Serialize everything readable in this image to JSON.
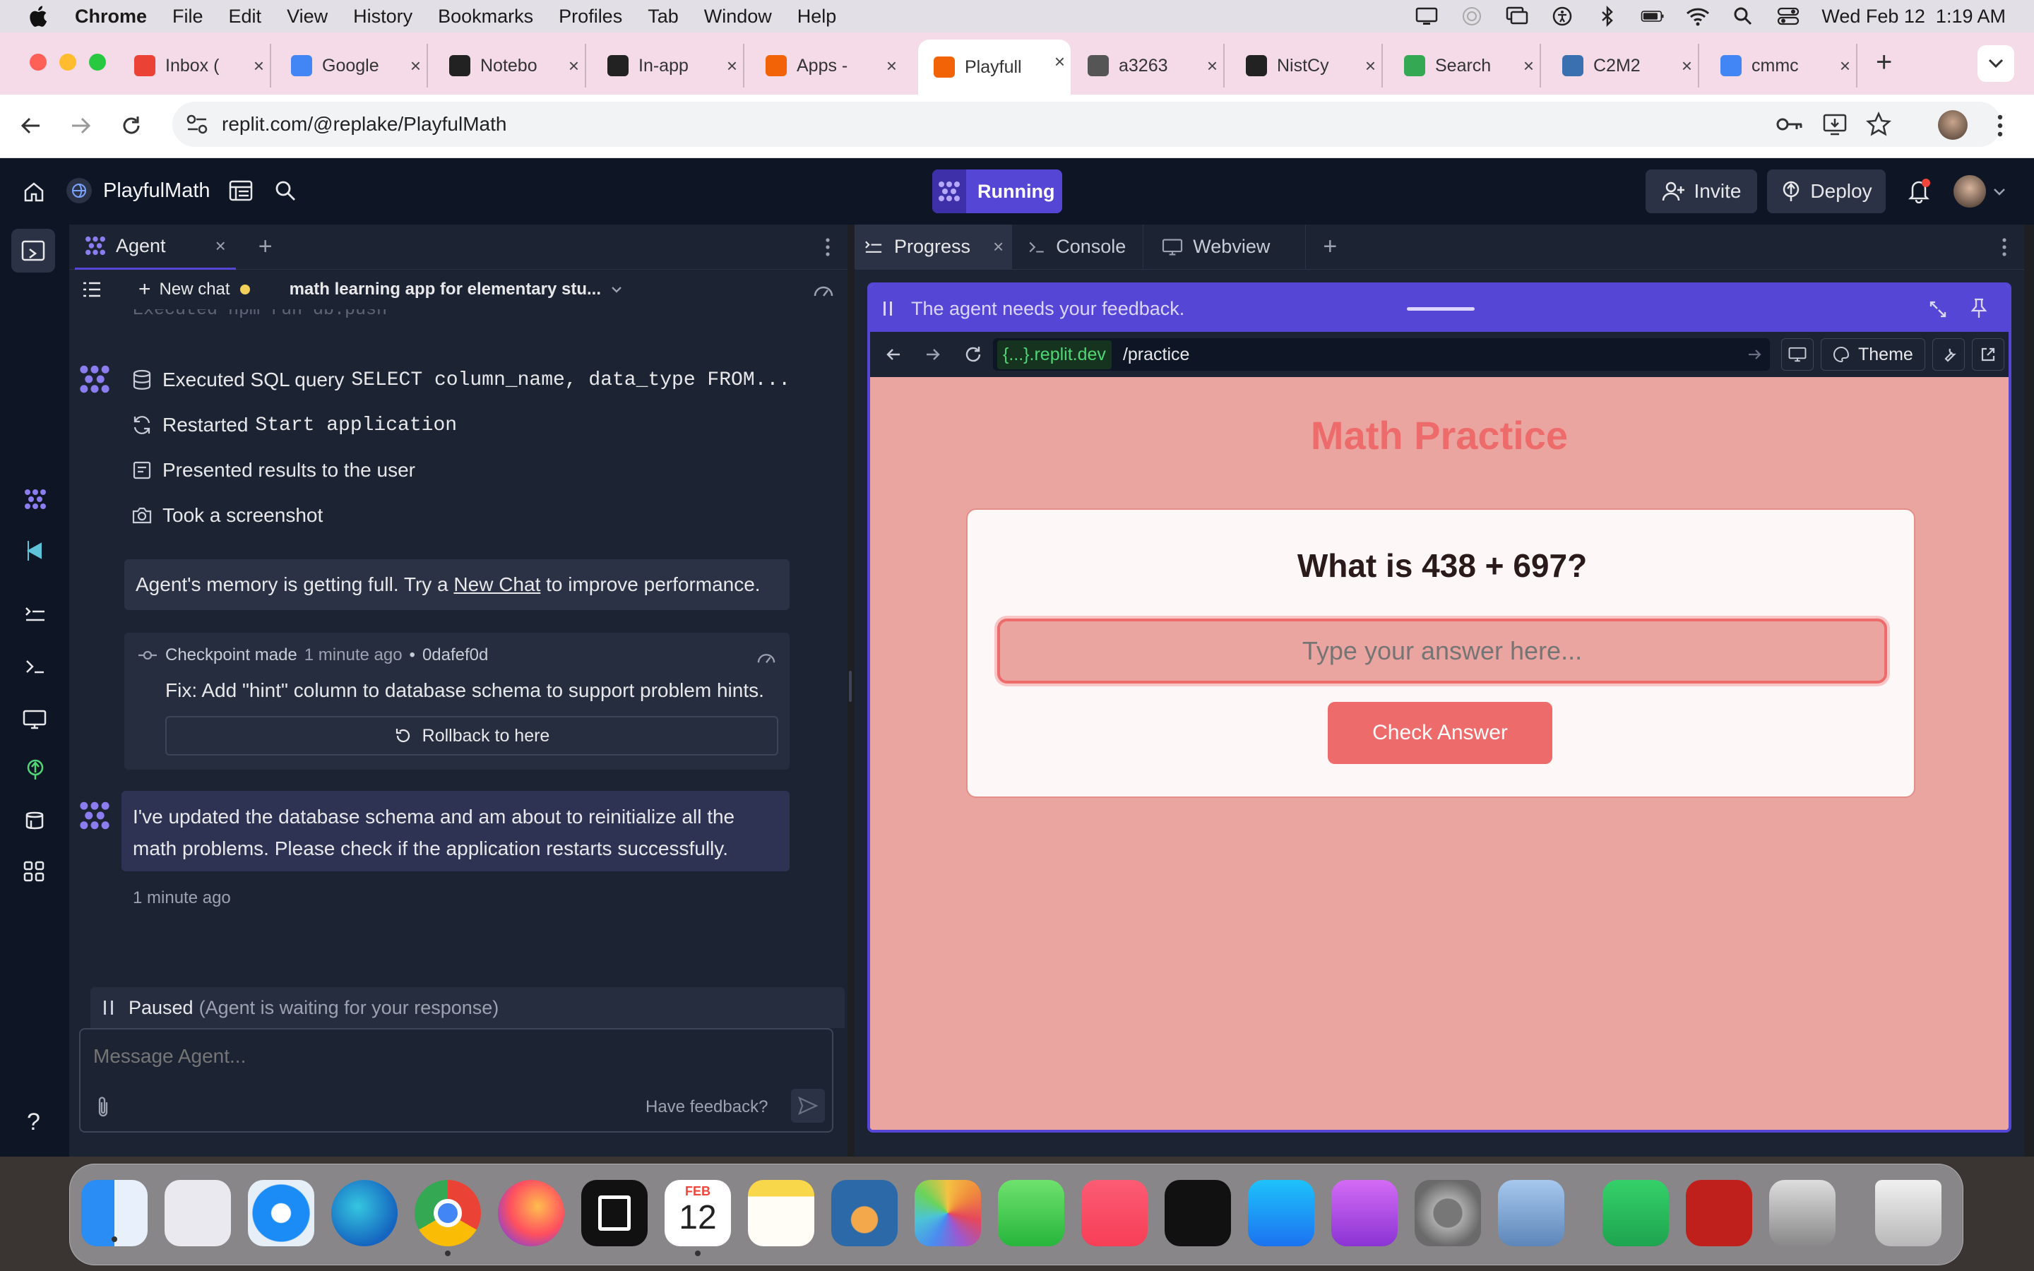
{
  "menubar": {
    "app": "Chrome",
    "items": [
      "File",
      "Edit",
      "View",
      "History",
      "Bookmarks",
      "Profiles",
      "Tab",
      "Window",
      "Help"
    ],
    "datetime": "Wed Feb 12  1:19 AM"
  },
  "tabs": [
    {
      "title": "Inbox (",
      "icon": "gmail-icon",
      "color": "#ea4335"
    },
    {
      "title": "Google",
      "icon": "google-calendar-icon",
      "color": "#4285f4"
    },
    {
      "title": "Notebo",
      "icon": "notebooklm-icon",
      "color": "#222222"
    },
    {
      "title": "In-app",
      "icon": "openai-icon",
      "color": "#222222"
    },
    {
      "title": "Apps -",
      "icon": "replit-icon",
      "color": "#f26207"
    },
    {
      "title": "Playfull",
      "icon": "replit-icon",
      "color": "#f26207"
    },
    {
      "title": "a3263",
      "icon": "globe-icon",
      "color": "#555555"
    },
    {
      "title": "NistCy",
      "icon": "github-icon",
      "color": "#222222"
    },
    {
      "title": "Search",
      "icon": "google-drive-icon",
      "color": "#34a853"
    },
    {
      "title": "C2M2",
      "icon": "c2m2-icon",
      "color": "#3a6fb0"
    },
    {
      "title": "cmmc",
      "icon": "google-icon",
      "color": "#4285f4"
    }
  ],
  "address": {
    "url": "replit.com/@replake/PlayfulMath"
  },
  "replit": {
    "project": "PlayfulMath",
    "run_status": "Running",
    "invite": "Invite",
    "deploy": "Deploy"
  },
  "agent": {
    "tab_label": "Agent",
    "new_chat": "New chat",
    "chat_title": "math learning app for elementary stu...",
    "scrolled_line": "Executed npm run db:push",
    "actions": [
      {
        "icon": "database-icon",
        "prefix": "Executed SQL query",
        "code": "SELECT column_name, data_type FROM..."
      },
      {
        "icon": "refresh-icon",
        "prefix": "Restarted",
        "code": "Start application"
      },
      {
        "icon": "presentation-icon",
        "prefix": "Presented results to the user",
        "code": ""
      },
      {
        "icon": "camera-icon",
        "prefix": "Took a screenshot",
        "code": ""
      }
    ],
    "memory_pre": "Agent's memory is getting full. Try a ",
    "memory_link": "New Chat",
    "memory_post": " to improve performance.",
    "checkpoint": {
      "label": "Checkpoint made",
      "time": "1 minute ago",
      "sep": "•",
      "hash": "0dafef0d",
      "message": "Fix: Add \"hint\" column to database schema to support problem hints.",
      "rollback": "Rollback to here"
    },
    "message": "I've updated the database schema and am about to reinitialize all the math problems. Please check if the application restarts successfully.",
    "message_time": "1 minute ago",
    "paused": "Paused",
    "paused_detail": "(Agent is waiting for your response)",
    "input_placeholder": "Message Agent...",
    "feedback": "Have feedback?"
  },
  "right": {
    "tabs": [
      "Progress",
      "Console",
      "Webview"
    ],
    "feedback_banner": "The agent needs your feedback.",
    "preview_domain": "{...}.replit.dev",
    "preview_path": "/practice",
    "theme": "Theme"
  },
  "app": {
    "title": "Math Practice",
    "question": "What is 438 + 697?",
    "answer_placeholder": "Type your answer here...",
    "check": "Check Answer"
  },
  "dock": {
    "calendar_month": "FEB",
    "calendar_day": "12"
  },
  "colors": {
    "replit_bg": "#1c2333",
    "replit_dark": "#0e1525",
    "accent_purple": "#5546d6",
    "app_bg": "#eba5a0",
    "app_red": "#ee6b6b",
    "tab_strip": "#f4dbe7"
  }
}
